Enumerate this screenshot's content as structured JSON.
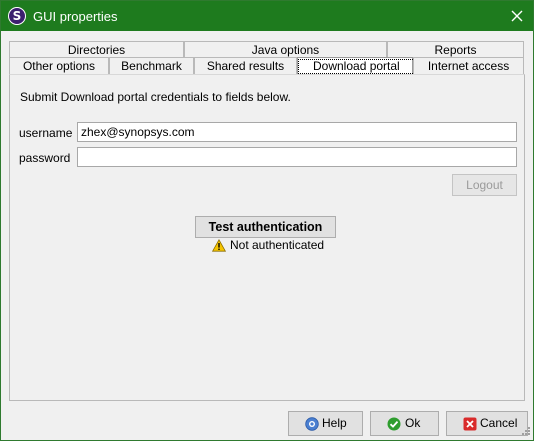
{
  "window": {
    "title": "GUI properties",
    "app_icon_letter": "S"
  },
  "tabs": {
    "top_row": [
      {
        "label": "Directories"
      },
      {
        "label": "Java options"
      },
      {
        "label": "Reports"
      }
    ],
    "bottom_row": [
      {
        "label": "Other options"
      },
      {
        "label": "Benchmark"
      },
      {
        "label": "Shared results"
      },
      {
        "label": "Download portal",
        "selected": true
      },
      {
        "label": "Internet access"
      }
    ]
  },
  "panel": {
    "intro": "Submit Download portal credentials to fields below.",
    "username_label": "username",
    "username_value": "zhex@synopsys.com",
    "password_label": "password",
    "password_value": "",
    "logout_label": "Logout",
    "test_auth_label": "Test authentication",
    "status_text": "Not authenticated"
  },
  "footer": {
    "help_label": "Help",
    "ok_label": "Ok",
    "cancel_label": "Cancel"
  },
  "colors": {
    "titlebar": "#1e7b1e",
    "app_icon": "#3b1f6e",
    "warning": "#f5c400"
  }
}
